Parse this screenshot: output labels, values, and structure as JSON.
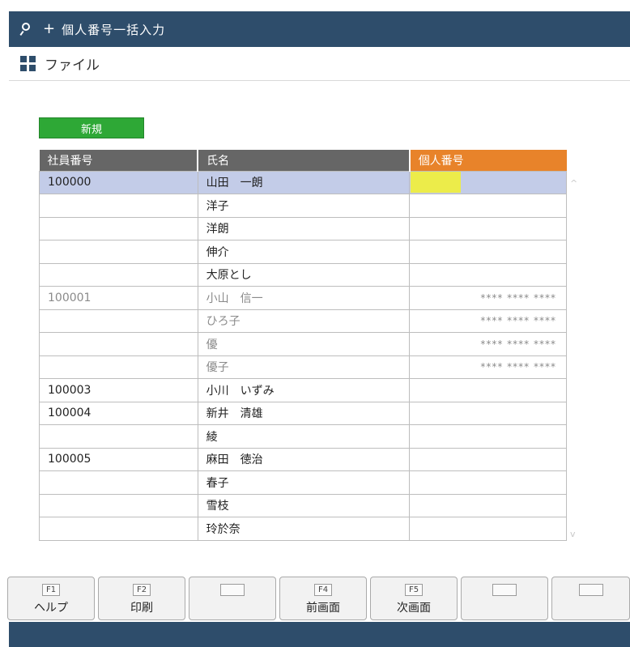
{
  "titlebar": {
    "plus": "+",
    "title": "個人番号一括入力"
  },
  "menubar": {
    "file_label": "ファイル"
  },
  "toolbar": {
    "new_label": "新規"
  },
  "table": {
    "headers": [
      "社員番号",
      "氏名",
      "個人番号"
    ],
    "rows": [
      {
        "emp_no": "100000",
        "name": "山田　一朗",
        "mynumber": ""
      },
      {
        "emp_no": "",
        "name": "洋子",
        "mynumber": ""
      },
      {
        "emp_no": "",
        "name": "洋朗",
        "mynumber": ""
      },
      {
        "emp_no": "",
        "name": "伸介",
        "mynumber": ""
      },
      {
        "emp_no": "",
        "name": "大原とし",
        "mynumber": ""
      },
      {
        "emp_no": "100001",
        "name": "小山　信一",
        "mynumber": "**** **** ****"
      },
      {
        "emp_no": "",
        "name": "ひろ子",
        "mynumber": "**** **** ****"
      },
      {
        "emp_no": "",
        "name": "優",
        "mynumber": "**** **** ****"
      },
      {
        "emp_no": "",
        "name": "優子",
        "mynumber": "**** **** ****"
      },
      {
        "emp_no": "100003",
        "name": "小川　いずみ",
        "mynumber": ""
      },
      {
        "emp_no": "100004",
        "name": "新井　清雄",
        "mynumber": ""
      },
      {
        "emp_no": "",
        "name": "綾",
        "mynumber": ""
      },
      {
        "emp_no": "100005",
        "name": "麻田　徳治",
        "mynumber": ""
      },
      {
        "emp_no": "",
        "name": "春子",
        "mynumber": ""
      },
      {
        "emp_no": "",
        "name": "雪枝",
        "mynumber": ""
      },
      {
        "emp_no": "",
        "name": "玲於奈",
        "mynumber": ""
      }
    ]
  },
  "scroll": {
    "up": "^",
    "down": "v"
  },
  "fkeys": [
    {
      "key": "F1",
      "label": "ヘルプ"
    },
    {
      "key": "F2",
      "label": "印刷"
    },
    {
      "key": "",
      "label": ""
    },
    {
      "key": "F4",
      "label": "前画面"
    },
    {
      "key": "F5",
      "label": "次画面"
    },
    {
      "key": "",
      "label": ""
    },
    {
      "key": "",
      "label": ""
    }
  ],
  "colors": {
    "titlebar": "#2e4d6b",
    "new_button": "#2ea836",
    "header_gray": "#666666",
    "header_orange": "#e8832a",
    "selected_row": "#c3cce8",
    "input_highlight": "#ecec4a"
  }
}
